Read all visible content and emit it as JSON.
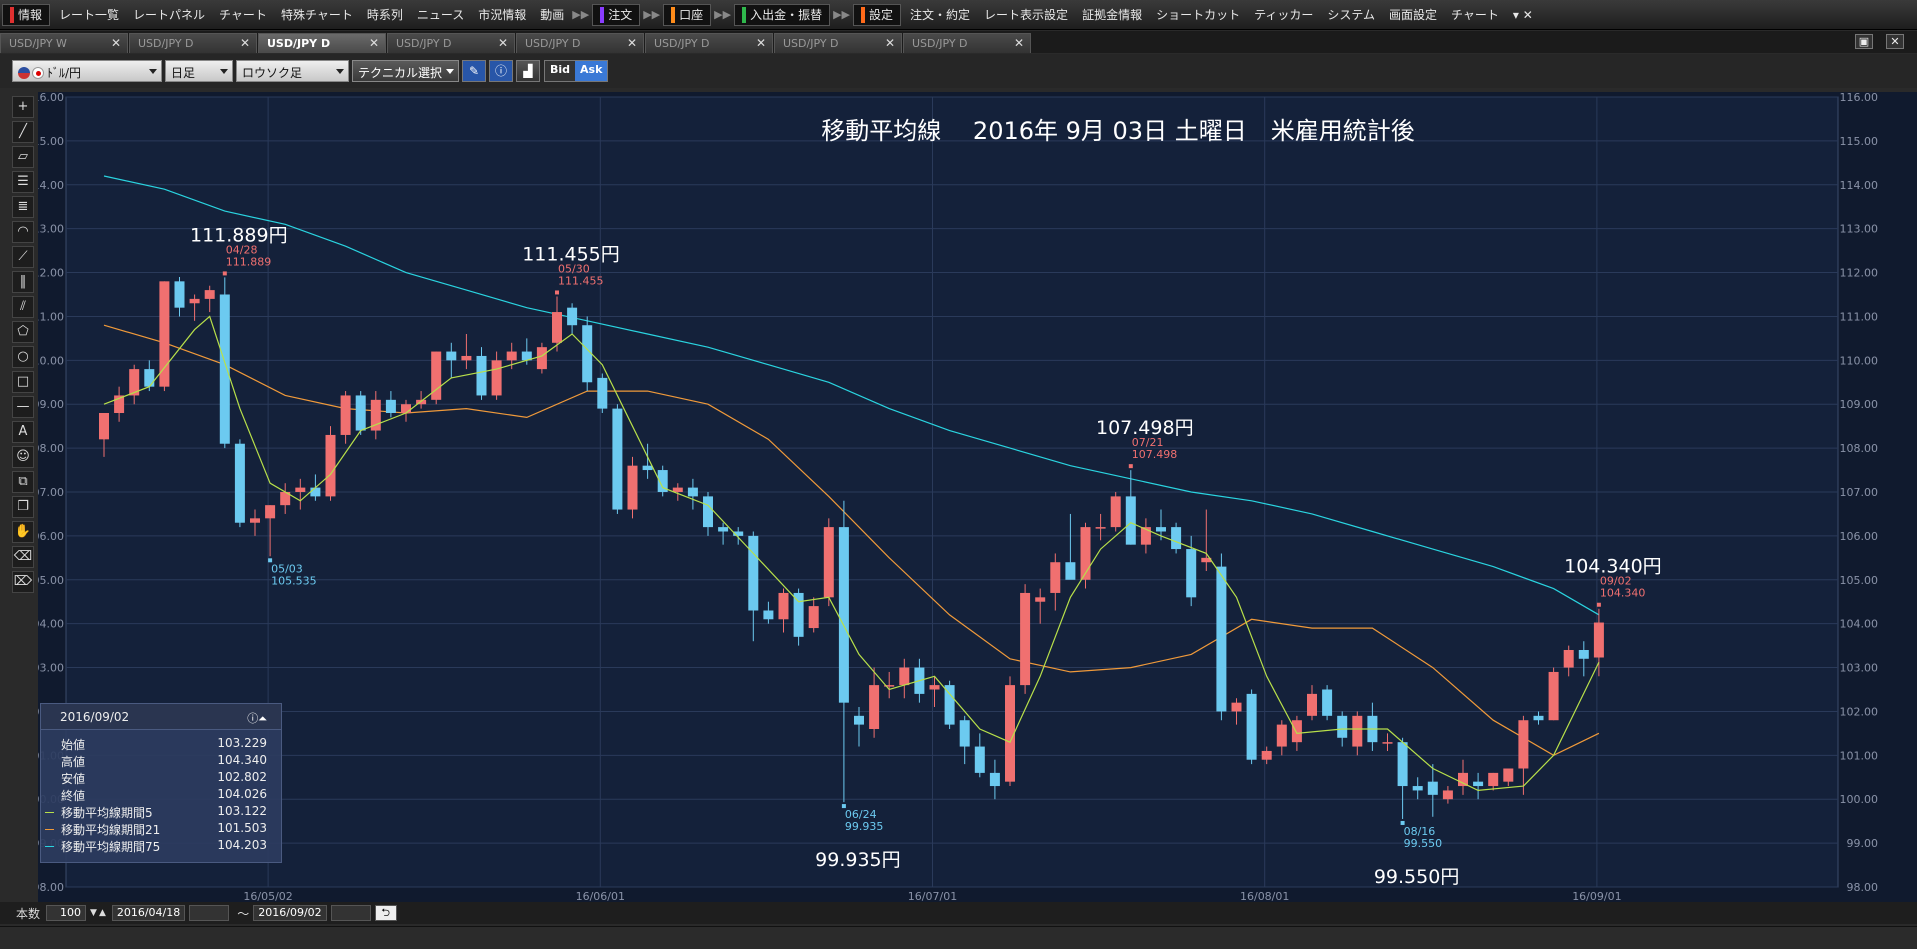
{
  "menu": {
    "items": [
      {
        "label": "情報",
        "color": "#e03030",
        "boxed": true
      },
      {
        "label": "レート一覧"
      },
      {
        "label": "レートパネル"
      },
      {
        "label": "チャート"
      },
      {
        "label": "特殊チャート"
      },
      {
        "label": "時系列"
      },
      {
        "label": "ニュース"
      },
      {
        "label": "市況情報"
      },
      {
        "label": "動画"
      },
      {
        "label": "注文",
        "color": "#8a3cff",
        "boxed": true,
        "sep": true
      },
      {
        "label": "口座",
        "color": "#ff8c1a",
        "boxed": true,
        "sep": true
      },
      {
        "label": "入出金・振替",
        "color": "#2fb84c",
        "boxed": true,
        "sep": true
      },
      {
        "label": "設定",
        "color": "#ff6a1a",
        "boxed": true,
        "sep": true
      },
      {
        "label": "注文・約定"
      },
      {
        "label": "レート表示設定"
      },
      {
        "label": "証拠金情報"
      },
      {
        "label": "ショートカット"
      },
      {
        "label": "ティッカー"
      },
      {
        "label": "システム"
      },
      {
        "label": "画面設定"
      },
      {
        "label": "チャート"
      }
    ]
  },
  "tabs": [
    {
      "label": "USD/JPY W",
      "active": false
    },
    {
      "label": "USD/JPY D",
      "active": false
    },
    {
      "label": "USD/JPY D",
      "active": true
    },
    {
      "label": "USD/JPY D",
      "active": false
    },
    {
      "label": "USD/JPY D",
      "active": false
    },
    {
      "label": "USD/JPY D",
      "active": false
    },
    {
      "label": "USD/JPY D",
      "active": false
    },
    {
      "label": "USD/JPY D",
      "active": false
    }
  ],
  "toolbar": {
    "pair": "ﾄﾞﾙ/円",
    "period": "日足",
    "chart_type": "ロウソク足",
    "technical": "テクニカル選択",
    "bid_label": "Bid",
    "ask_label": "Ask"
  },
  "info_panel": {
    "date": "2016/09/02",
    "rows": [
      {
        "label": "始値",
        "value": "103.229"
      },
      {
        "label": "高値",
        "value": "104.340"
      },
      {
        "label": "安値",
        "value": "102.802"
      },
      {
        "label": "終値",
        "value": "104.026"
      },
      {
        "label": "移動平均線期間5",
        "value": "103.122",
        "color": "#b8e04a"
      },
      {
        "label": "移動平均線期間21",
        "value": "101.503",
        "color": "#f09a3a"
      },
      {
        "label": "移動平均線期間75",
        "value": "104.203",
        "color": "#2ad4e0"
      }
    ]
  },
  "bottom": {
    "bars_label": "本数",
    "bars_value": "100",
    "from_date": "2016/04/18",
    "tilde": "〜",
    "to_date": "2016/09/02"
  },
  "chart_data": {
    "type": "candlestick",
    "title": "移動平均線　 2016年 9月 03日 土曜日　米雇用統計後",
    "ylim": [
      98.0,
      116.0
    ],
    "y_ticks": [
      "116.00",
      "115.00",
      "114.00",
      "113.00",
      "112.00",
      "111.00",
      "110.00",
      "109.00",
      "108.00",
      "107.00",
      "106.00",
      "105.00",
      "104.00",
      "103.00",
      "102.00",
      "101.00",
      "100.00",
      "99.00",
      "98.00"
    ],
    "x_ticks": [
      {
        "label": "16/05/02",
        "index": 11
      },
      {
        "label": "16/06/01",
        "index": 33
      },
      {
        "label": "16/07/01",
        "index": 55
      },
      {
        "label": "16/08/01",
        "index": 77
      },
      {
        "label": "16/09/01",
        "index": 99
      }
    ],
    "colors": {
      "up": "#f07070",
      "down": "#6ccaf0",
      "background": "#14213a",
      "grid": "#2a3a5a"
    },
    "candles": [
      {
        "o": 108.2,
        "h": 108.7,
        "l": 107.8,
        "c": 108.8
      },
      {
        "o": 108.8,
        "h": 109.4,
        "l": 108.6,
        "c": 109.2
      },
      {
        "o": 109.2,
        "h": 109.9,
        "l": 109.0,
        "c": 109.8
      },
      {
        "o": 109.8,
        "h": 110.0,
        "l": 109.3,
        "c": 109.4
      },
      {
        "o": 109.4,
        "h": 111.8,
        "l": 109.3,
        "c": 111.8
      },
      {
        "o": 111.8,
        "h": 111.9,
        "l": 111.0,
        "c": 111.2
      },
      {
        "o": 111.3,
        "h": 111.5,
        "l": 110.9,
        "c": 111.4
      },
      {
        "o": 111.4,
        "h": 111.7,
        "l": 111.1,
        "c": 111.6
      },
      {
        "o": 111.5,
        "h": 111.889,
        "l": 108.0,
        "c": 108.1
      },
      {
        "o": 108.1,
        "h": 108.2,
        "l": 106.2,
        "c": 106.3
      },
      {
        "o": 106.3,
        "h": 106.6,
        "l": 106.0,
        "c": 106.4
      },
      {
        "o": 106.4,
        "h": 106.7,
        "l": 105.535,
        "c": 106.7
      },
      {
        "o": 106.7,
        "h": 107.2,
        "l": 106.5,
        "c": 107.0
      },
      {
        "o": 107.0,
        "h": 107.3,
        "l": 106.6,
        "c": 107.1
      },
      {
        "o": 107.1,
        "h": 107.4,
        "l": 106.8,
        "c": 106.9
      },
      {
        "o": 106.9,
        "h": 108.5,
        "l": 106.8,
        "c": 108.3
      },
      {
        "o": 108.3,
        "h": 109.3,
        "l": 108.1,
        "c": 109.2
      },
      {
        "o": 109.2,
        "h": 109.3,
        "l": 108.3,
        "c": 108.4
      },
      {
        "o": 108.4,
        "h": 109.3,
        "l": 108.2,
        "c": 109.1
      },
      {
        "o": 109.1,
        "h": 109.3,
        "l": 108.7,
        "c": 108.8
      },
      {
        "o": 108.8,
        "h": 109.1,
        "l": 108.6,
        "c": 109.0
      },
      {
        "o": 109.0,
        "h": 109.3,
        "l": 108.9,
        "c": 109.1
      },
      {
        "o": 109.1,
        "h": 110.2,
        "l": 109.0,
        "c": 110.2
      },
      {
        "o": 110.2,
        "h": 110.4,
        "l": 109.6,
        "c": 110.0
      },
      {
        "o": 110.0,
        "h": 110.6,
        "l": 109.8,
        "c": 110.1
      },
      {
        "o": 110.1,
        "h": 110.3,
        "l": 109.1,
        "c": 109.2
      },
      {
        "o": 109.2,
        "h": 110.2,
        "l": 109.1,
        "c": 110.0
      },
      {
        "o": 110.0,
        "h": 110.4,
        "l": 109.8,
        "c": 110.2
      },
      {
        "o": 110.2,
        "h": 110.5,
        "l": 109.9,
        "c": 110.0
      },
      {
        "o": 109.8,
        "h": 110.4,
        "l": 109.7,
        "c": 110.3
      },
      {
        "o": 110.4,
        "h": 111.455,
        "l": 110.2,
        "c": 111.1
      },
      {
        "o": 111.2,
        "h": 111.3,
        "l": 110.6,
        "c": 110.8
      },
      {
        "o": 110.8,
        "h": 111.0,
        "l": 109.3,
        "c": 109.5
      },
      {
        "o": 109.6,
        "h": 109.7,
        "l": 108.8,
        "c": 108.9
      },
      {
        "o": 108.9,
        "h": 109.0,
        "l": 106.5,
        "c": 106.6
      },
      {
        "o": 106.6,
        "h": 107.8,
        "l": 106.4,
        "c": 107.6
      },
      {
        "o": 107.6,
        "h": 108.1,
        "l": 107.3,
        "c": 107.5
      },
      {
        "o": 107.5,
        "h": 107.6,
        "l": 106.9,
        "c": 107.0
      },
      {
        "o": 107.0,
        "h": 107.2,
        "l": 106.8,
        "c": 107.1
      },
      {
        "o": 107.1,
        "h": 107.3,
        "l": 106.6,
        "c": 106.9
      },
      {
        "o": 106.9,
        "h": 107.0,
        "l": 106.0,
        "c": 106.2
      },
      {
        "o": 106.2,
        "h": 106.3,
        "l": 105.8,
        "c": 106.1
      },
      {
        "o": 106.1,
        "h": 106.2,
        "l": 105.8,
        "c": 106.0
      },
      {
        "o": 106.0,
        "h": 106.1,
        "l": 103.6,
        "c": 104.3
      },
      {
        "o": 104.3,
        "h": 104.5,
        "l": 104.0,
        "c": 104.1
      },
      {
        "o": 104.1,
        "h": 104.8,
        "l": 103.8,
        "c": 104.7
      },
      {
        "o": 104.7,
        "h": 104.8,
        "l": 103.5,
        "c": 103.7
      },
      {
        "o": 103.9,
        "h": 104.6,
        "l": 103.8,
        "c": 104.4
      },
      {
        "o": 104.6,
        "h": 106.4,
        "l": 104.4,
        "c": 106.2
      },
      {
        "o": 106.2,
        "h": 106.8,
        "l": 99.935,
        "c": 102.2
      },
      {
        "o": 101.9,
        "h": 102.1,
        "l": 101.2,
        "c": 101.7
      },
      {
        "o": 101.6,
        "h": 103.0,
        "l": 101.4,
        "c": 102.6
      },
      {
        "o": 102.6,
        "h": 102.9,
        "l": 102.3,
        "c": 102.6
      },
      {
        "o": 102.6,
        "h": 103.2,
        "l": 102.3,
        "c": 103.0
      },
      {
        "o": 103.0,
        "h": 103.2,
        "l": 102.2,
        "c": 102.4
      },
      {
        "o": 102.5,
        "h": 102.8,
        "l": 102.1,
        "c": 102.6
      },
      {
        "o": 102.6,
        "h": 102.7,
        "l": 101.6,
        "c": 101.7
      },
      {
        "o": 101.8,
        "h": 101.9,
        "l": 100.8,
        "c": 101.2
      },
      {
        "o": 101.2,
        "h": 101.5,
        "l": 100.5,
        "c": 100.6
      },
      {
        "o": 100.6,
        "h": 100.9,
        "l": 100.0,
        "c": 100.3
      },
      {
        "o": 100.4,
        "h": 102.8,
        "l": 100.3,
        "c": 102.6
      },
      {
        "o": 102.6,
        "h": 104.9,
        "l": 102.4,
        "c": 104.7
      },
      {
        "o": 104.5,
        "h": 104.8,
        "l": 104.0,
        "c": 104.6
      },
      {
        "o": 104.7,
        "h": 105.6,
        "l": 104.3,
        "c": 105.4
      },
      {
        "o": 105.4,
        "h": 106.5,
        "l": 105.1,
        "c": 105.0
      },
      {
        "o": 105.0,
        "h": 106.3,
        "l": 104.8,
        "c": 106.2
      },
      {
        "o": 106.2,
        "h": 106.5,
        "l": 105.9,
        "c": 106.2
      },
      {
        "o": 106.2,
        "h": 107.0,
        "l": 106.1,
        "c": 106.9
      },
      {
        "o": 106.9,
        "h": 107.498,
        "l": 105.8,
        "c": 105.8
      },
      {
        "o": 105.8,
        "h": 106.4,
        "l": 105.6,
        "c": 106.2
      },
      {
        "o": 106.2,
        "h": 106.6,
        "l": 105.9,
        "c": 106.1
      },
      {
        "o": 106.2,
        "h": 106.3,
        "l": 105.6,
        "c": 105.7
      },
      {
        "o": 105.7,
        "h": 106.0,
        "l": 104.4,
        "c": 104.6
      },
      {
        "o": 105.4,
        "h": 106.6,
        "l": 105.2,
        "c": 105.5
      },
      {
        "o": 105.3,
        "h": 105.6,
        "l": 101.8,
        "c": 102.0
      },
      {
        "o": 102.0,
        "h": 102.3,
        "l": 101.7,
        "c": 102.2
      },
      {
        "o": 102.4,
        "h": 102.5,
        "l": 100.8,
        "c": 100.9
      },
      {
        "o": 100.9,
        "h": 101.2,
        "l": 100.8,
        "c": 101.1
      },
      {
        "o": 101.2,
        "h": 101.8,
        "l": 101.0,
        "c": 101.7
      },
      {
        "o": 101.3,
        "h": 101.9,
        "l": 101.1,
        "c": 101.8
      },
      {
        "o": 101.9,
        "h": 102.6,
        "l": 101.8,
        "c": 102.4
      },
      {
        "o": 102.5,
        "h": 102.6,
        "l": 101.8,
        "c": 101.9
      },
      {
        "o": 101.9,
        "h": 102.0,
        "l": 101.2,
        "c": 101.4
      },
      {
        "o": 101.2,
        "h": 102.0,
        "l": 101.0,
        "c": 101.9
      },
      {
        "o": 101.9,
        "h": 102.2,
        "l": 101.1,
        "c": 101.3
      },
      {
        "o": 101.3,
        "h": 101.5,
        "l": 101.1,
        "c": 101.3
      },
      {
        "o": 101.3,
        "h": 101.4,
        "l": 99.55,
        "c": 100.3
      },
      {
        "o": 100.3,
        "h": 100.5,
        "l": 100.0,
        "c": 100.2
      },
      {
        "o": 100.4,
        "h": 100.8,
        "l": 99.6,
        "c": 100.1
      },
      {
        "o": 100.0,
        "h": 100.3,
        "l": 99.9,
        "c": 100.2
      },
      {
        "o": 100.3,
        "h": 100.9,
        "l": 100.1,
        "c": 100.6
      },
      {
        "o": 100.4,
        "h": 100.6,
        "l": 100.0,
        "c": 100.3
      },
      {
        "o": 100.3,
        "h": 100.6,
        "l": 100.2,
        "c": 100.6
      },
      {
        "o": 100.4,
        "h": 100.7,
        "l": 100.3,
        "c": 100.7
      },
      {
        "o": 100.7,
        "h": 101.9,
        "l": 100.1,
        "c": 101.8
      },
      {
        "o": 101.9,
        "h": 102.0,
        "l": 101.7,
        "c": 101.8
      },
      {
        "o": 101.8,
        "h": 103.0,
        "l": 101.8,
        "c": 102.9
      },
      {
        "o": 103.0,
        "h": 103.5,
        "l": 102.8,
        "c": 103.4
      },
      {
        "o": 103.4,
        "h": 103.6,
        "l": 102.8,
        "c": 103.2
      },
      {
        "o": 103.229,
        "h": 104.34,
        "l": 102.802,
        "c": 104.026
      }
    ],
    "ma75": [
      [
        0,
        114.2
      ],
      [
        4,
        113.9
      ],
      [
        8,
        113.4
      ],
      [
        12,
        113.1
      ],
      [
        16,
        112.6
      ],
      [
        20,
        112.0
      ],
      [
        24,
        111.6
      ],
      [
        28,
        111.2
      ],
      [
        32,
        110.9
      ],
      [
        36,
        110.6
      ],
      [
        40,
        110.3
      ],
      [
        44,
        109.9
      ],
      [
        48,
        109.5
      ],
      [
        52,
        108.9
      ],
      [
        56,
        108.4
      ],
      [
        60,
        108.0
      ],
      [
        64,
        107.6
      ],
      [
        68,
        107.3
      ],
      [
        72,
        107.0
      ],
      [
        76,
        106.8
      ],
      [
        80,
        106.5
      ],
      [
        84,
        106.1
      ],
      [
        88,
        105.7
      ],
      [
        92,
        105.3
      ],
      [
        96,
        104.8
      ],
      [
        99,
        104.203
      ]
    ],
    "ma21": [
      [
        0,
        110.8
      ],
      [
        4,
        110.4
      ],
      [
        8,
        109.9
      ],
      [
        12,
        109.2
      ],
      [
        16,
        108.9
      ],
      [
        20,
        108.8
      ],
      [
        24,
        108.9
      ],
      [
        28,
        108.7
      ],
      [
        32,
        109.3
      ],
      [
        36,
        109.3
      ],
      [
        40,
        109.0
      ],
      [
        44,
        108.2
      ],
      [
        48,
        106.9
      ],
      [
        52,
        105.5
      ],
      [
        56,
        104.2
      ],
      [
        60,
        103.2
      ],
      [
        64,
        102.9
      ],
      [
        68,
        103.0
      ],
      [
        72,
        103.3
      ],
      [
        76,
        104.1
      ],
      [
        80,
        103.9
      ],
      [
        84,
        103.9
      ],
      [
        88,
        103.0
      ],
      [
        92,
        101.8
      ],
      [
        96,
        101.0
      ],
      [
        99,
        101.503
      ]
    ],
    "ma5": [
      [
        0,
        109.0
      ],
      [
        3,
        109.4
      ],
      [
        6,
        110.7
      ],
      [
        7,
        111.0
      ],
      [
        9,
        108.9
      ],
      [
        11,
        107.2
      ],
      [
        13,
        106.8
      ],
      [
        15,
        107.4
      ],
      [
        17,
        108.4
      ],
      [
        20,
        108.8
      ],
      [
        23,
        109.6
      ],
      [
        26,
        109.8
      ],
      [
        29,
        110.1
      ],
      [
        31,
        110.6
      ],
      [
        33,
        109.9
      ],
      [
        35,
        108.5
      ],
      [
        37,
        107.1
      ],
      [
        40,
        106.7
      ],
      [
        43,
        105.6
      ],
      [
        46,
        104.5
      ],
      [
        48,
        104.6
      ],
      [
        50,
        103.3
      ],
      [
        52,
        102.5
      ],
      [
        55,
        102.8
      ],
      [
        58,
        101.6
      ],
      [
        60,
        101.3
      ],
      [
        62,
        102.8
      ],
      [
        64,
        104.6
      ],
      [
        66,
        105.7
      ],
      [
        68,
        106.3
      ],
      [
        70,
        106.0
      ],
      [
        73,
        105.6
      ],
      [
        75,
        104.6
      ],
      [
        77,
        102.8
      ],
      [
        79,
        101.5
      ],
      [
        82,
        101.6
      ],
      [
        85,
        101.6
      ],
      [
        88,
        100.7
      ],
      [
        91,
        100.2
      ],
      [
        94,
        100.3
      ],
      [
        96,
        101.0
      ],
      [
        99,
        103.122
      ]
    ],
    "annotations": [
      {
        "index": 8,
        "price": 111.889,
        "big": "111.889円",
        "date": "04/28",
        "value": "111.889",
        "kind": "high"
      },
      {
        "index": 30,
        "price": 111.455,
        "big": "111.455円",
        "date": "05/30",
        "value": "111.455",
        "kind": "high"
      },
      {
        "index": 11,
        "price": 105.535,
        "big": "",
        "date": "05/03",
        "value": "105.535",
        "kind": "low"
      },
      {
        "index": 49,
        "price": 99.935,
        "big": "99.935円",
        "date": "06/24",
        "value": "99.935",
        "kind": "low"
      },
      {
        "index": 68,
        "price": 107.498,
        "big": "107.498円",
        "date": "07/21",
        "value": "107.498",
        "kind": "high"
      },
      {
        "index": 86,
        "price": 99.55,
        "big": "99.550円",
        "date": "08/16",
        "value": "99.550",
        "kind": "low"
      },
      {
        "index": 99,
        "price": 104.34,
        "big": "104.340円",
        "date": "09/02",
        "value": "104.340",
        "kind": "high"
      }
    ]
  }
}
